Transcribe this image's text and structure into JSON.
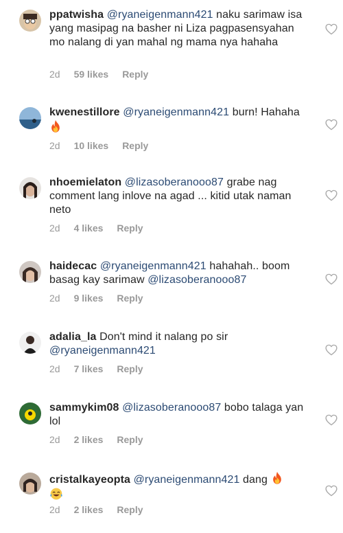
{
  "comments": [
    {
      "username": "ppatwisha",
      "mention": "@ryaneigenmann421",
      "text": " naku sarimaw isa yang masipag na basher ni Liza pagpasensyahan mo nalang di yan mahal ng mama nya hahaha",
      "time": "2d",
      "likes": "59 likes",
      "reply": "Reply"
    },
    {
      "username": "kwenestillore",
      "mention": "@ryaneigenmann421",
      "text": " burn! Hahaha ",
      "emoji": "fire",
      "time": "2d",
      "likes": "10 likes",
      "reply": "Reply"
    },
    {
      "username": "nhoemielaton",
      "mention": "@lizasoberanooo87",
      "text": " grabe nag comment lang inlove na agad ... kitid utak naman neto",
      "time": "2d",
      "likes": "4 likes",
      "reply": "Reply"
    },
    {
      "username": "haidecac",
      "mention": "@ryaneigenmann421",
      "text": " hahahah.. boom basag kay sarimaw ",
      "mention2": "@lizasoberanooo87",
      "time": "2d",
      "likes": "9 likes",
      "reply": "Reply"
    },
    {
      "username": "adalia_la",
      "text": "Don't mind it nalang po sir ",
      "mention": "@ryaneigenmann421",
      "time": "2d",
      "likes": "7 likes",
      "reply": "Reply"
    },
    {
      "username": "sammykim08",
      "mention": "@lizasoberanooo87",
      "text": " bobo talaga yan lol",
      "time": "2d",
      "likes": "2 likes",
      "reply": "Reply"
    },
    {
      "username": "cristalkayeopta",
      "mention": "@ryaneigenmann421",
      "text": " dang ",
      "emoji": "fire",
      "emoji2": "joy",
      "time": "2d",
      "likes": "2 likes",
      "reply": "Reply"
    }
  ],
  "icons": {
    "like": "heart-outline-icon",
    "fire": "fire-emoji",
    "joy": "tears-of-joy-emoji"
  },
  "colors": {
    "username": "#262626",
    "mention": "#2b4a73",
    "meta": "#999999",
    "heart": "#a8a8a8"
  }
}
